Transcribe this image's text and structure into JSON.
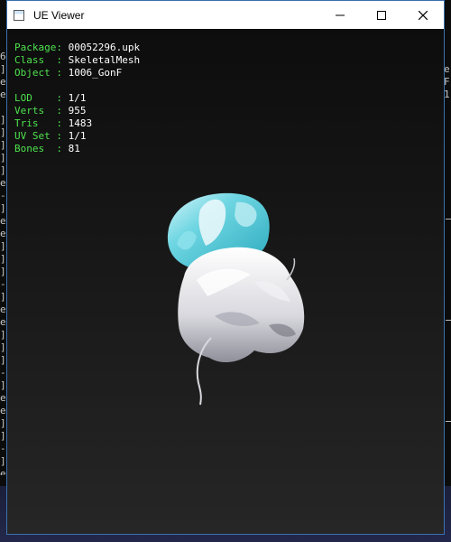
{
  "window": {
    "title": "UE Viewer",
    "minimize_glyph": "—",
    "maximize_glyph": "☐",
    "close_glyph": "✕",
    "app_icon": "window-app-icon",
    "border_color": "#3b6fb0"
  },
  "info": {
    "package": {
      "label": "Package: ",
      "value": "00052296.upk"
    },
    "class": {
      "label": "Class  : ",
      "value": "SkeletalMesh"
    },
    "object": {
      "label": "Object : ",
      "value": "1006_GonF"
    },
    "lod": {
      "label": "LOD    : ",
      "value": "1/1"
    },
    "verts": {
      "label": "Verts  : ",
      "value": "955"
    },
    "tris": {
      "label": "Tris   : ",
      "value": "1483"
    },
    "uvset": {
      "label": "UV Set : ",
      "value": "1/1"
    },
    "bones": {
      "label": "Bones  : ",
      "value": "81"
    }
  },
  "colors": {
    "label_green": "#4ee24e",
    "value_white": "#ffffff",
    "mesh_cyan": "#55c8d6",
    "mesh_white": "#e6e6ea"
  },
  "background_console": {
    "left_fragment": "6\n]\ne\ne\n\n]\n]\n]\n]\n]\ne\n-\n]\ne\ne\n]\n]\n]\n-\n]\ne\ne\n]\n]\n]\n-\n]\ne\ne\n]\n]\n-\n]\ne\n]",
    "right_fragment": "e\nF\n1"
  }
}
